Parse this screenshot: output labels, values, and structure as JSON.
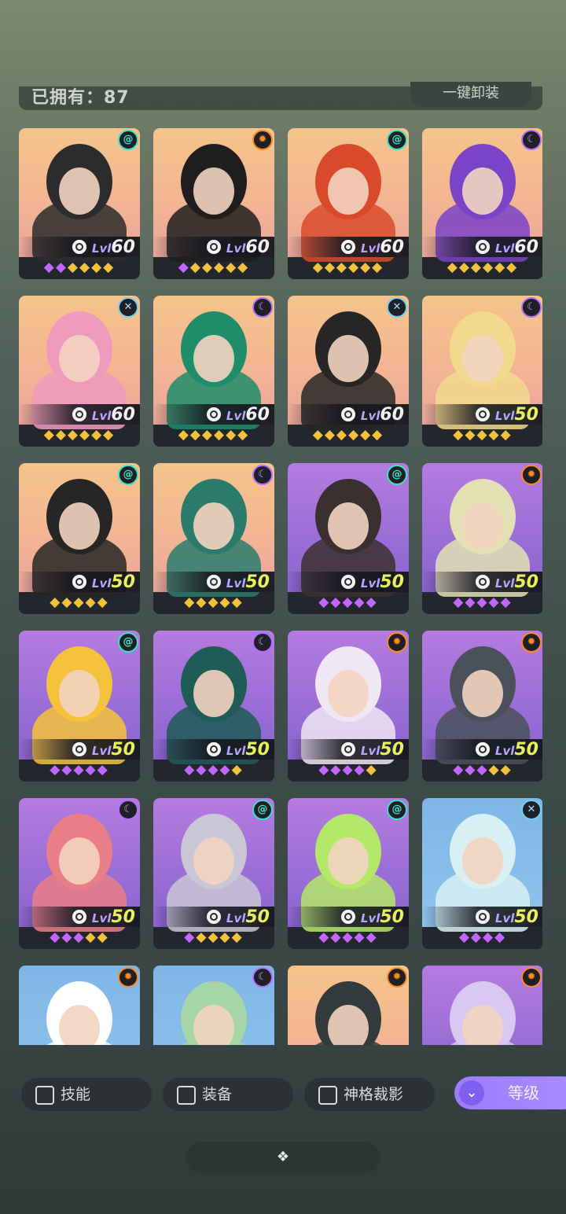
{
  "header": {
    "owned_text": "已拥有：87",
    "unequip_label": "一键卸装"
  },
  "cards": [
    {
      "level": "60",
      "bg": "peach",
      "badge": "spiral",
      "gems": "pp gggg",
      "art": "#2c2c2c"
    },
    {
      "level": "60",
      "bg": "peach",
      "badge": "sun",
      "gems": "p ggggg",
      "art": "#1e1e1e"
    },
    {
      "level": "60",
      "bg": "peach",
      "badge": "spiral",
      "gems": "gggggg",
      "art": "#d94a2a"
    },
    {
      "level": "60",
      "bg": "peach",
      "badge": "moon",
      "gems": "gggggg",
      "art": "#7a43c8"
    },
    {
      "level": "60",
      "bg": "peach",
      "badge": "cross",
      "gems": "gggggg",
      "art": "#ef9bbd"
    },
    {
      "level": "60",
      "bg": "peach",
      "badge": "moon",
      "gems": "gggggg",
      "art": "#1f8c6a"
    },
    {
      "level": "60",
      "bg": "peach",
      "badge": "cross",
      "gems": "gggggg",
      "art": "#262626"
    },
    {
      "level": "50",
      "bg": "peach",
      "badge": "moon",
      "gems": "ggggg",
      "art": "#f2d98d"
    },
    {
      "level": "50",
      "bg": "peach",
      "badge": "spiral",
      "gems": "ggggg",
      "art": "#262626"
    },
    {
      "level": "50",
      "bg": "peach",
      "badge": "moon",
      "gems": "ggggg",
      "art": "#2b7b6c"
    },
    {
      "level": "50",
      "bg": "purple",
      "badge": "spiral",
      "gems": "ppppp",
      "art": "#3b3030"
    },
    {
      "level": "50",
      "bg": "purple",
      "badge": "sun",
      "gems": "ppppp",
      "art": "#e3e0b4"
    },
    {
      "level": "50",
      "bg": "purple",
      "badge": "spiral",
      "gems": "ppppp",
      "art": "#f5c33b"
    },
    {
      "level": "50",
      "bg": "purple",
      "badge": "moon",
      "gems": "ppppg",
      "art": "#1f5b57"
    },
    {
      "level": "50",
      "bg": "purple",
      "badge": "sun",
      "gems": "ppppg",
      "art": "#efe7f3"
    },
    {
      "level": "50",
      "bg": "purple",
      "badge": "sun",
      "gems": "pppgg",
      "art": "#4a515a"
    },
    {
      "level": "50",
      "bg": "purple",
      "badge": "moon",
      "gems": "pppgg",
      "art": "#ea7e87"
    },
    {
      "level": "50",
      "bg": "purple",
      "badge": "spiral",
      "gems": "pgggg",
      "art": "#c9c6d6"
    },
    {
      "level": "50",
      "bg": "purple",
      "badge": "spiral",
      "gems": "ppppp",
      "art": "#b4e868"
    },
    {
      "level": "50",
      "bg": "blue",
      "badge": "cross",
      "gems": "pppp",
      "art": "#d8f0f4"
    },
    {
      "level": "",
      "bg": "blue",
      "badge": "sun",
      "gems": "",
      "art": "#ffffff"
    },
    {
      "level": "",
      "bg": "blue",
      "badge": "moon",
      "gems": "",
      "art": "#a6d6a8"
    },
    {
      "level": "",
      "bg": "peach",
      "badge": "sun",
      "gems": "",
      "art": "#333a3b"
    },
    {
      "level": "",
      "bg": "purple",
      "badge": "sun",
      "gems": "",
      "art": "#d9c8f2"
    }
  ],
  "lvl_prefix": "Lvl",
  "filters": [
    {
      "label": "技能"
    },
    {
      "label": "装备"
    },
    {
      "label": "神格裁影"
    }
  ],
  "sort_button": {
    "label": "等级",
    "icon": "double-chevron-down-icon"
  },
  "bottom_button": {
    "icon": "diamonds-icon"
  }
}
